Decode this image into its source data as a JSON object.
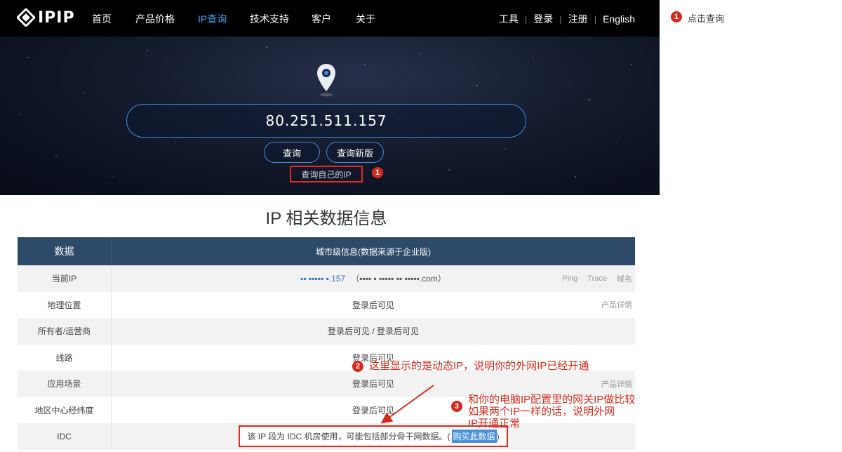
{
  "brand": {
    "name": "IPIP"
  },
  "nav": {
    "items": [
      {
        "label": "首页",
        "active": false
      },
      {
        "label": "产品价格",
        "active": false
      },
      {
        "label": "IP查询",
        "active": true
      },
      {
        "label": "技术支持",
        "active": false
      },
      {
        "label": "客户",
        "active": false
      },
      {
        "label": "关于",
        "active": false
      }
    ],
    "right": {
      "tools": "工具",
      "login": "登录",
      "register": "注册",
      "language": "English"
    }
  },
  "hero": {
    "ip_value": "80.251.511.157",
    "query_label": "查询",
    "query_new_label": "查询新版",
    "self_ip_label": "查询自己的IP"
  },
  "annotations": {
    "step1_number": "1",
    "step1_text": "点击查询",
    "step2_number": "2",
    "step2_text": "这里显示的是动态IP，说明你的外网IP已经开通",
    "step3_number": "3",
    "step3_lines": [
      "和你的电脑IP配置里的网关IP做比较",
      "如果两个IP一样的话，说明外网",
      "IP开通正常"
    ],
    "accent_color": "#d42a1e"
  },
  "section": {
    "title": "IP 相关数据信息"
  },
  "table": {
    "header": {
      "col1": "数据",
      "col2": "城市级信息(数据来源于企业版)"
    },
    "rows": [
      {
        "label": "当前IP",
        "ip": "▪▪ ▪▪▪▪▪ ▪.157",
        "host": "（▪▪▪▪ ▪ ▪▪▪▪▪ ▪▪ ▪▪▪▪▪.com）",
        "extras": [
          "Ping",
          "Trace",
          "域名"
        ]
      },
      {
        "label": "地理位置",
        "value": "登录后可见",
        "extras": [
          "产品详情"
        ]
      },
      {
        "label": "所有者/运营商",
        "value": "登录后可见 / 登录后可见",
        "extras": []
      },
      {
        "label": "线路",
        "value": "登录后可见",
        "extras": []
      },
      {
        "label": "应用场景",
        "value": "登录后可见",
        "extras": [
          "产品详情"
        ]
      },
      {
        "label": "地区中心经纬度",
        "value": "登录后可见",
        "extras": []
      },
      {
        "label": "IDC",
        "value": "该 IP 段为 IDC 机房使用，可能包括部分骨干网数据。(",
        "link": "购买此数据",
        "value_tail": ")"
      }
    ]
  },
  "colors": {
    "nav_bg": "#000000",
    "nav_active": "#3ca4f3",
    "table_header": "#2d4a68",
    "link_blue": "#3b6fb5"
  }
}
